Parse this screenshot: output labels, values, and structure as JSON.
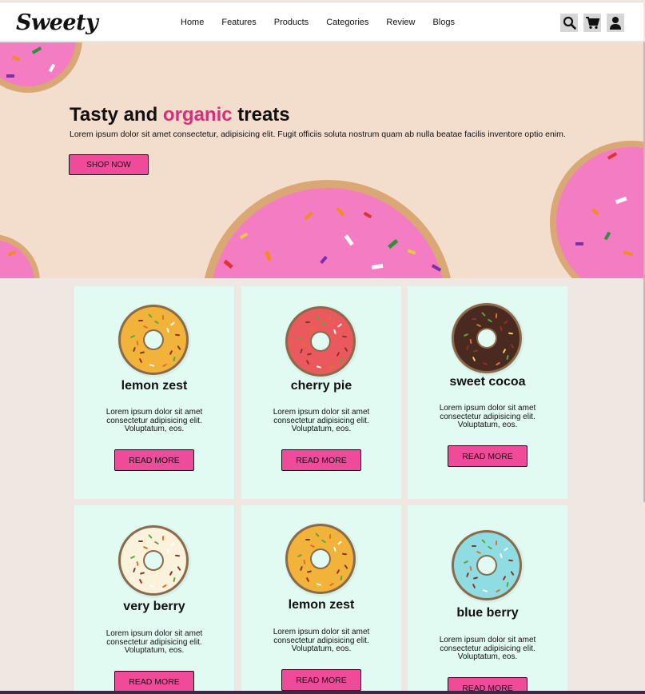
{
  "brand": {
    "name": "Sweety"
  },
  "nav": {
    "items": [
      "Home",
      "Features",
      "Products",
      "Categories",
      "Review",
      "Blogs"
    ]
  },
  "header_icons": [
    "search-icon",
    "cart-icon",
    "user-icon"
  ],
  "hero": {
    "title_start": "Tasty and ",
    "title_accent": "organic",
    "title_end": " treats",
    "text": "Lorem ipsum dolor sit amet consectetur, adipisicing elit. Fugit officiis soluta nostrum quam ab nulla beatae facilis inventore optio enim.",
    "button": "SHOP NOW"
  },
  "colors": {
    "accent": "#d62f7c",
    "button": "#f04a9a",
    "card_bg": "#e2fbf2"
  },
  "products": [
    {
      "name": "lemon zest",
      "desc": "Lorem ipsum dolor sit amet consectetur adipisicing elit. Voluptatum, eos.",
      "button": "READ MORE",
      "icing": "#f2b33a"
    },
    {
      "name": "cherry pie",
      "desc": "Lorem ipsum dolor sit amet consectetur adipisicing elit. Voluptatum, eos.",
      "button": "READ MORE",
      "icing": "#ea5a5c"
    },
    {
      "name": "sweet cocoa",
      "desc": "Lorem ipsum dolor sit amet consectetur adipisicing elit. Voluptatum, eos.",
      "button": "READ MORE",
      "icing": "#4a2a20"
    },
    {
      "name": "very berry",
      "desc": "Lorem ipsum dolor sit amet consectetur adipisicing elit. Voluptatum, eos.",
      "button": "READ MORE",
      "icing": "#fbf2dc"
    },
    {
      "name": "lemon zest",
      "desc": "Lorem ipsum dolor sit amet consectetur adipisicing elit. Voluptatum, eos.",
      "button": "READ MORE",
      "icing": "#f2b33a"
    },
    {
      "name": "blue berry",
      "desc": "Lorem ipsum dolor sit amet consectetur adipisicing elit. Voluptatum, eos.",
      "button": "READ MORE",
      "icing": "#8fdde2"
    }
  ]
}
